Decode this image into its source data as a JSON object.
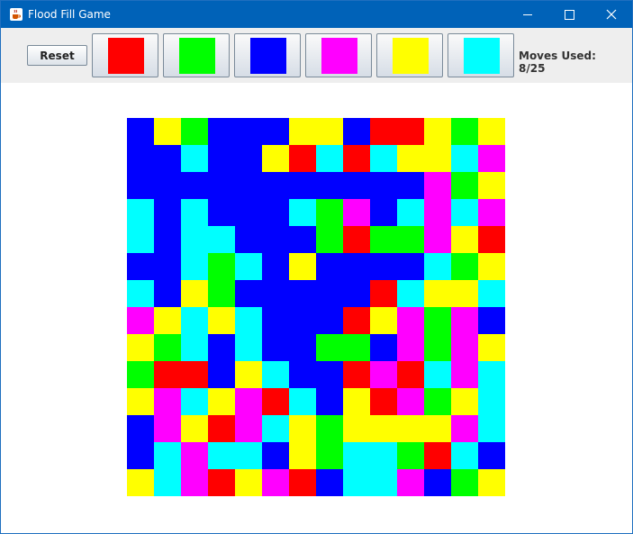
{
  "window": {
    "title": "Flood Fill Game",
    "titlebar_color": "#0062b8",
    "icons": {
      "app": "java-cup-icon",
      "minimize": "minimize-icon",
      "maximize": "maximize-icon",
      "close": "close-icon"
    }
  },
  "toolbar": {
    "reset_label": "Reset",
    "colors": [
      {
        "name": "red",
        "hex": "#ff0000"
      },
      {
        "name": "green",
        "hex": "#00ff00"
      },
      {
        "name": "blue",
        "hex": "#0000ff"
      },
      {
        "name": "magenta",
        "hex": "#ff00ff"
      },
      {
        "name": "yellow",
        "hex": "#ffff00"
      },
      {
        "name": "cyan",
        "hex": "#00ffff"
      }
    ],
    "moves_label": "Moves Used:",
    "moves_used": "8/25"
  },
  "board": {
    "palette": {
      "R": "#ff0000",
      "G": "#00ff00",
      "B": "#0000ff",
      "M": "#ff00ff",
      "Y": "#ffff00",
      "C": "#00ffff"
    },
    "rows": [
      "BYGBBBYYBRRYGY",
      "BBCBBYRCRCYYCM",
      "BBBBBBBBBBBMGY",
      "CBCBBBCGMBCMCM",
      "CBCCBBBGRGGMYR",
      "BBCGCBYBBBBCGY",
      "CBYGBBBBBRCYYC",
      "MYCYCBBBRYMGMB",
      "YGCBCBBGGBMGMY",
      "GRRBYCBBRMRCMC",
      "YMCYMRCBYRMGYC",
      "BMYRMCYGYYYYMC",
      "BCMCCBYGCCGRCB",
      "YCMRYMRBCCMBGY"
    ]
  }
}
